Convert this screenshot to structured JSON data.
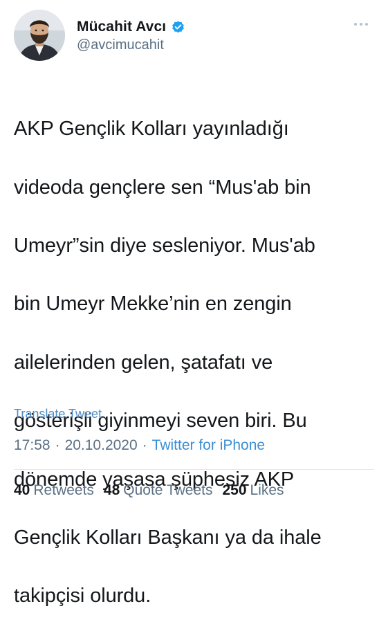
{
  "author": {
    "display_name": "Mücahit Avcı",
    "handle": "@avcimucahit",
    "verified_icon": "verified-badge-icon",
    "verified_color": "#1da1f2"
  },
  "more_icon": "more-horizontal-icon",
  "tweet": {
    "lines": [
      "AKP Gençlik Kolları yayınladığı",
      "videoda gençlere sen “Mus'ab bin",
      "Umeyr”sin diye sesleniyor. Mus'ab",
      "bin Umeyr Mekke’nin en zengin",
      "ailelerinden gelen, şatafatı ve",
      "gösterişli giyinmeyi seven biri. Bu",
      "dönemde yaşasa şüphesiz AKP",
      "Gençlik Kolları Başkanı ya da ihale",
      "takipçisi olurdu."
    ],
    "translate_label": "Translate Tweet",
    "time": "17:58",
    "separator": "·",
    "date": "20.10.2020",
    "source": "Twitter for iPhone"
  },
  "stats": {
    "retweets_count": "40",
    "retweets_label": "Retweets",
    "quotes_count": "48",
    "quotes_label": "Quote Tweets",
    "likes_count": "250",
    "likes_label": "Likes"
  },
  "colors": {
    "text": "#14171a",
    "secondary": "#5b7083",
    "link": "#3b8fd6"
  }
}
